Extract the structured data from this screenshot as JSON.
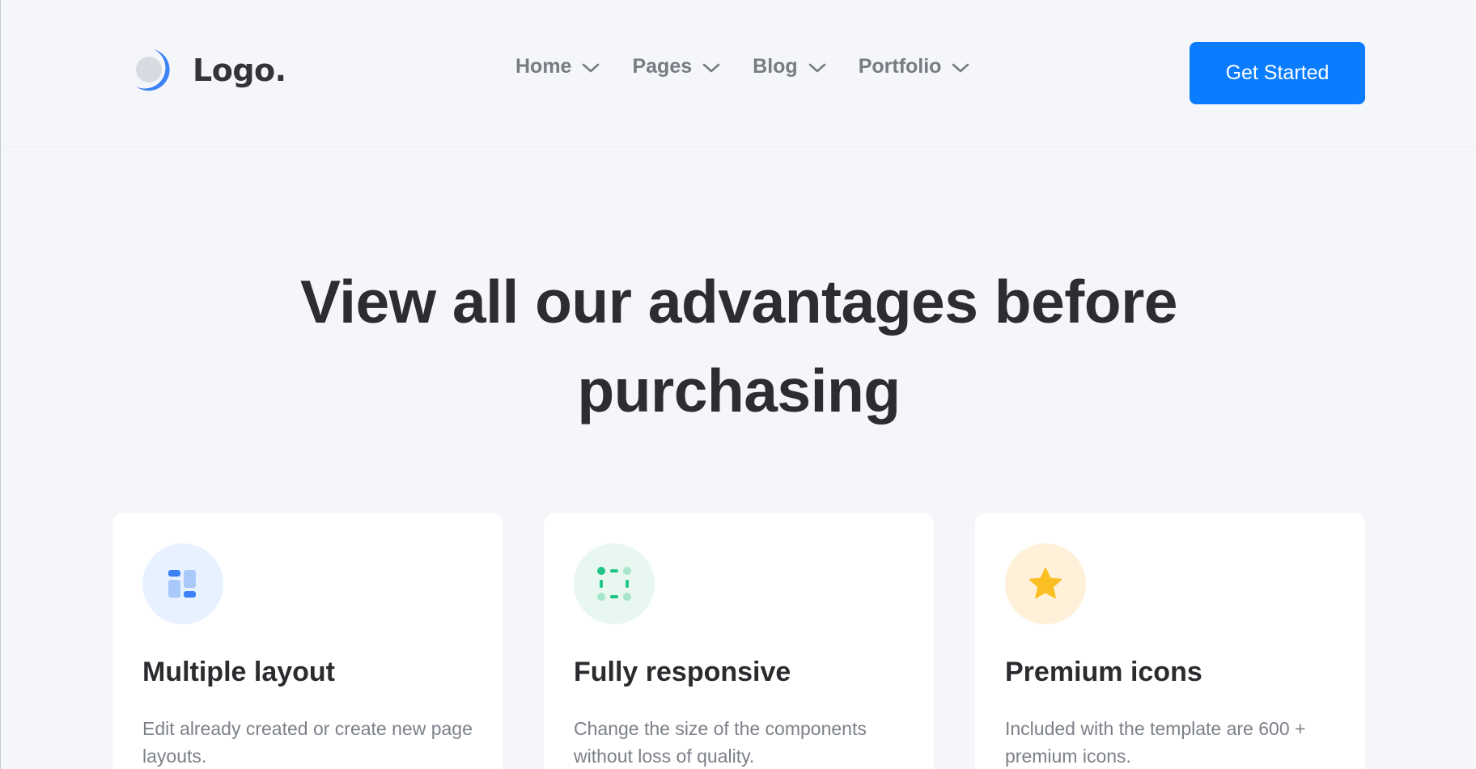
{
  "brand": {
    "name": "Logo.",
    "accent": "#3b82f6"
  },
  "nav": {
    "items": [
      {
        "label": "Home",
        "icon": "chevron-down-icon"
      },
      {
        "label": "Pages",
        "icon": "chevron-down-icon"
      },
      {
        "label": "Blog",
        "icon": "chevron-down-icon"
      },
      {
        "label": "Portfolio",
        "icon": "chevron-down-icon"
      }
    ]
  },
  "header": {
    "cta_label": "Get Started",
    "cta_color": "#0a7cff"
  },
  "hero": {
    "title": "View all our advantages before purchasing"
  },
  "features": [
    {
      "title": "Multiple layout",
      "text": "Edit already created or create new page layouts.",
      "icon": "layout-icon",
      "icon_bg": "#e7f1ff",
      "icon_color": "#3b82f6"
    },
    {
      "title": "Fully responsive",
      "text": "Change the size of the components without loss of quality.",
      "icon": "responsive-frame-icon",
      "icon_bg": "#e8f7f0",
      "icon_color": "#22c48a"
    },
    {
      "title": "Premium icons",
      "text": "Included with the template are 600 + premium icons.",
      "icon": "star-icon",
      "icon_bg": "#fff1d9",
      "icon_color": "#fbbf24"
    }
  ]
}
